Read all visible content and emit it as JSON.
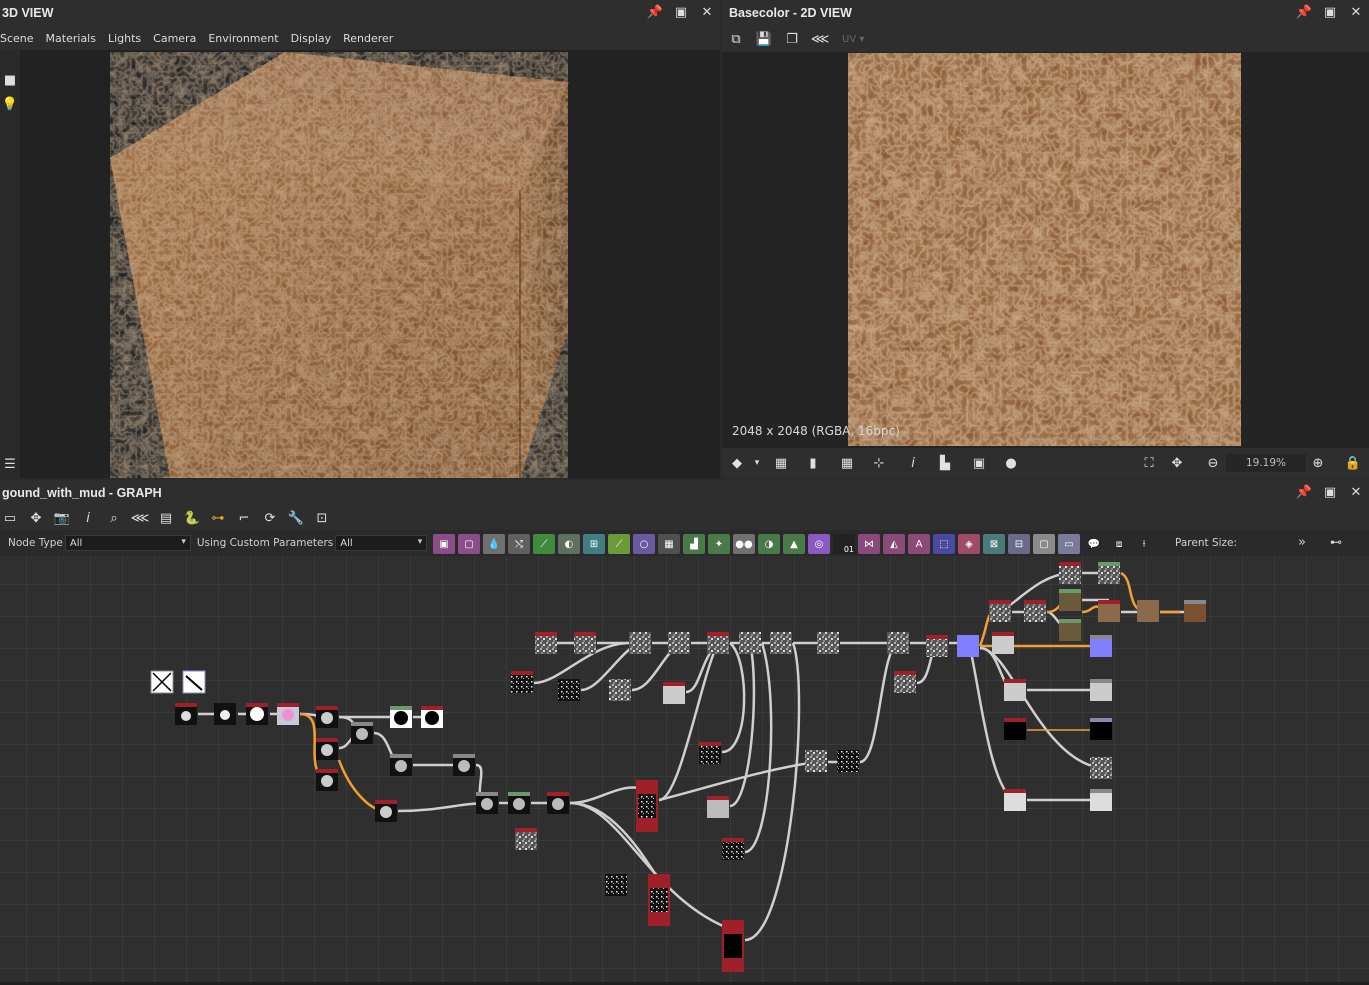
{
  "view3d": {
    "title": "3D VIEW",
    "menu": [
      "Scene",
      "Materials",
      "Lights",
      "Camera",
      "Environment",
      "Display",
      "Renderer"
    ],
    "side_icons": [
      "camera-icon",
      "light-bulb-icon",
      "layers-icon"
    ]
  },
  "view2d": {
    "title": "Basecolor - 2D VIEW",
    "uv_label": "UV",
    "resolution": "2048 x 2048 (RGBA, 16bpc)",
    "zoom": "19.19%",
    "colors": {
      "dirt_base": "#8a5a33",
      "dirt_light": "#a97a4c",
      "dirt_dark": "#5e3a1e"
    }
  },
  "graph": {
    "title": "gound_with_mud - GRAPH",
    "filter": {
      "node_type_label": "Node Type",
      "node_type_value": "All",
      "custom_params_label": "Using Custom Parameters",
      "custom_params_value": "All"
    },
    "parent_size_label": "Parent Size:",
    "more_label": "»",
    "lib_tag": "01",
    "lib_letter": "A"
  }
}
